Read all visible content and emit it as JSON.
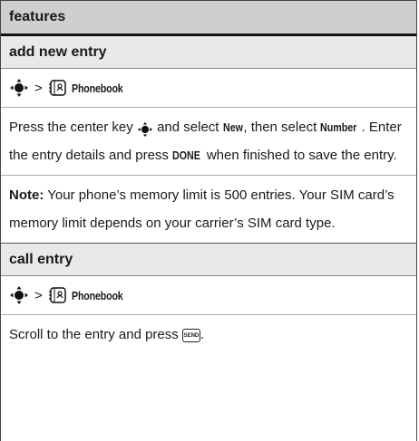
{
  "header": {
    "title": "features"
  },
  "sections": [
    {
      "title": "add new entry",
      "path_label": "Phonebook",
      "para1": {
        "t1": "Press the center key ",
        "t2": " and select ",
        "kw_new": "New",
        "t3": ", then select ",
        "kw_number": "Number",
        "t4": ". Enter the entry details and press ",
        "kw_done": "DONE",
        "t5": " when finished to save the entry."
      },
      "note": {
        "label": "Note:",
        "text": " Your phone’s memory limit is 500 entries. Your SIM card’s memory limit depends on your carrier’s SIM card type."
      }
    },
    {
      "title": "call entry",
      "path_label": "Phonebook",
      "para": {
        "t1": "Scroll to the entry and press ",
        "key": "SEND",
        "t2": "."
      }
    }
  ],
  "icons": {
    "nav": "nav-key-icon",
    "phonebook": "phonebook-icon",
    "send": "send-key-icon"
  }
}
